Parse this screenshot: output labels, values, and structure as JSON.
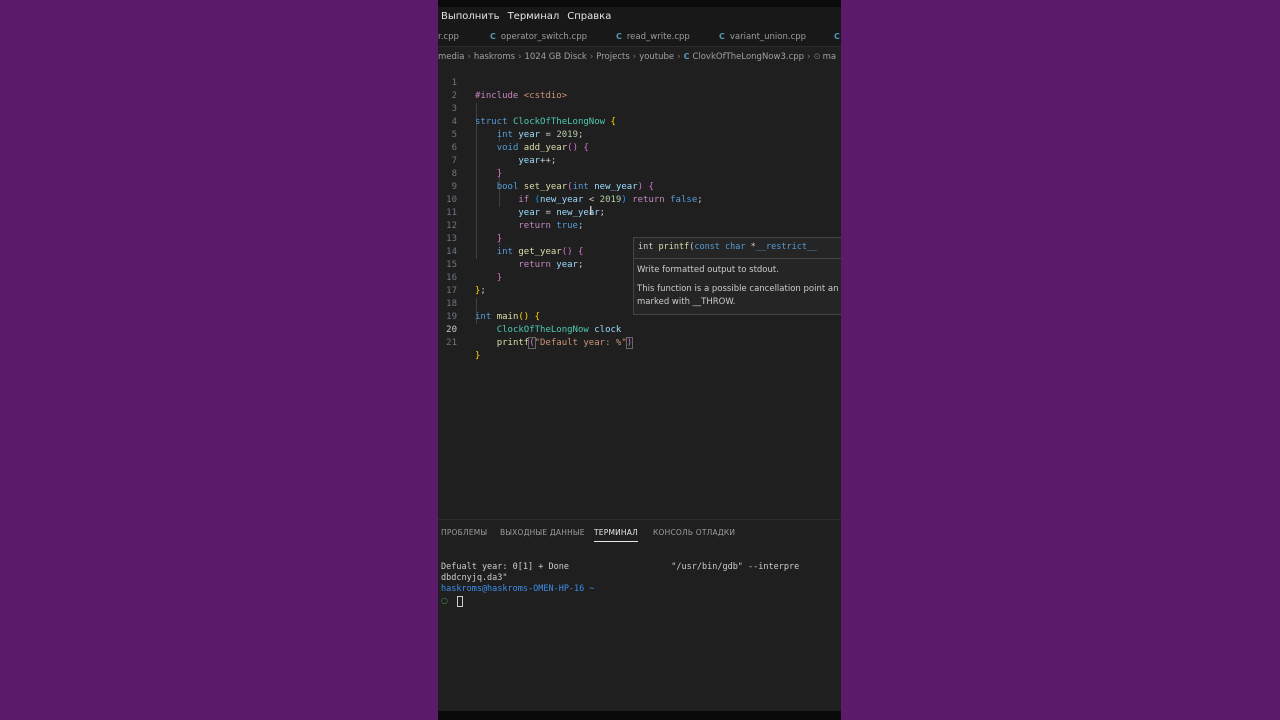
{
  "menubar": {
    "items": [
      "Выполнить",
      "Терминал",
      "Справка"
    ]
  },
  "tabs": [
    {
      "label": "r.cpp",
      "icon": "cpp-file-icon"
    },
    {
      "label": "operator_switch.cpp",
      "icon": "cpp-file-icon"
    },
    {
      "label": "read_write.cpp",
      "icon": "cpp-file-icon"
    },
    {
      "label": "variant_union.cpp",
      "icon": "cpp-file-icon"
    }
  ],
  "breadcrumb": {
    "items": [
      "media",
      "haskroms",
      "1024 GB Disck",
      "Projects",
      "youtube",
      "ClovkOfTheLongNow3.cpp",
      "ma"
    ]
  },
  "editor": {
    "line_numbers": [
      "1",
      "2",
      "3",
      "4",
      "5",
      "6",
      "7",
      "8",
      "9",
      "10",
      "11",
      "12",
      "13",
      "14",
      "15",
      "16",
      "17",
      "18",
      "19",
      "20",
      "21"
    ],
    "active_line": "20"
  },
  "hover": {
    "signature": "int printf(const char *__restrict__",
    "line1": "Write formatted output to stdout.",
    "line2": "This function is a possible cancellation point an",
    "line3": "marked with __THROW."
  },
  "panel": {
    "tabs": [
      "ПРОБЛЕМЫ",
      "ВЫХОДНЫЕ ДАННЫЕ",
      "ТЕРМИНАЛ",
      "КОНСОЛЬ ОТЛАДКИ"
    ],
    "active_tab": "ТЕРМИНАЛ",
    "terminal_lines": [
      "Defualt year: 0[1] + Done                    \"/usr/bin/gdb\" --interpre",
      "dbdcnyjq.da3\"",
      "haskroms@haskroms-OMEN-HP-16 ~"
    ]
  },
  "colors": {
    "background": "#5c1a6b",
    "editor_bg": "#1f1f1f",
    "keyword": "#569cd6",
    "control": "#c586c0",
    "type": "#4ec9b0",
    "function": "#dcdcaa",
    "number": "#b5cea8",
    "string": "#ce9178",
    "variable": "#9cdcfe"
  }
}
